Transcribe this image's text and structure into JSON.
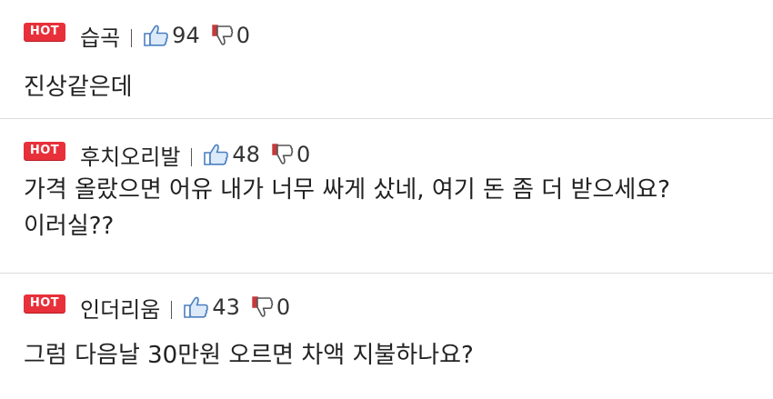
{
  "comments": [
    {
      "badge": "HOT",
      "nickname": "습곡",
      "likes": "94",
      "dislikes": "0",
      "text": "진상같은데"
    },
    {
      "badge": "HOT",
      "nickname": "후치오리발",
      "likes": "48",
      "dislikes": "0",
      "text": "가격 올랐으면 어유 내가 너무 싸게 샀네, 여기 돈 좀 더 받으세요?\n이러실??"
    },
    {
      "badge": "HOT",
      "nickname": "인더리움",
      "likes": "43",
      "dislikes": "0",
      "text": "그럼 다음날 30만원 오르면 차액 지불하나요?"
    }
  ],
  "colors": {
    "hot_badge": "#e8303a",
    "like_icon": "#4a7fc1",
    "dislike_icon": "#c43a3a",
    "divider": "#dcdcdc"
  },
  "icons": {
    "like": "thumbs-up-icon",
    "dislike": "thumbs-down-icon"
  }
}
